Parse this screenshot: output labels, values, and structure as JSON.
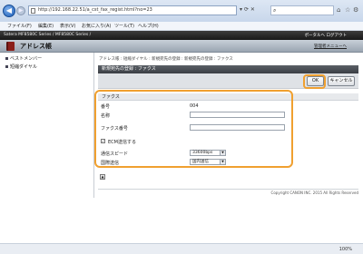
{
  "browser": {
    "url": "http://192.168.22.51/a_cst_fax_regist.html?no=23",
    "search_icon": "search-icon",
    "menus": [
      "ファイル(F)",
      "編集(E)",
      "表示(V)",
      "お気に入り(A)",
      "ツール(T)",
      "ヘルプ(H)"
    ],
    "zoom": "100%"
  },
  "header": {
    "device_line": "Satera   MF8580C Series / MF8580C Series /",
    "app_title": "アドレス帳",
    "portal_link": "ポータルへ  ログアウト",
    "mgmt_link": "管理者メニューへ"
  },
  "sidebar": {
    "items": [
      "ベストメンバー",
      "短縮ダイヤル"
    ]
  },
  "main": {
    "breadcrumb": "アドレス帳 : 短縮ダイヤル : 新規宛先の登録 : 新規宛先の登録 : ファクス",
    "panel_title": "新規宛先の登録 : ファクス",
    "ok_label": "OK",
    "cancel_label": "キャンセル",
    "section_title": "ファクス",
    "fields": {
      "number_label": "番号",
      "number_value": "004",
      "name_label": "名称",
      "fax_label": "ファクス番号",
      "ecm_label": "ECM送信する",
      "speed_label": "通信スピード",
      "speed_value": "33600bps",
      "intl_label": "国際送信",
      "intl_value": "国内送信"
    },
    "copyright": "Copyright CANON INC. 2015 All Rights Reserved"
  }
}
